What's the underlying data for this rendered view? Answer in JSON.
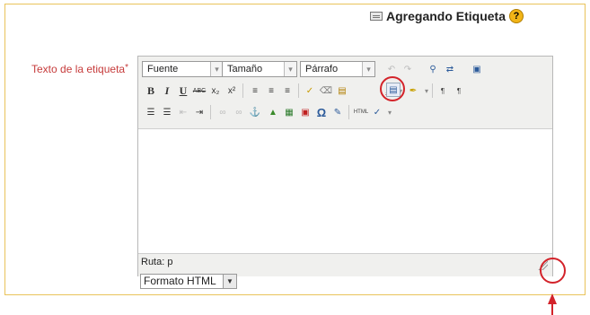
{
  "heading": {
    "title": "Agregando Etiqueta",
    "help_glyph": "?"
  },
  "field": {
    "label": "Texto de la etiqueta",
    "required_mark": "*"
  },
  "toolbar": {
    "font_select": "Fuente",
    "size_select": "Tamaño",
    "format_select": "Párrafo",
    "bold": "B",
    "italic": "I",
    "underline": "U",
    "strike": "ABC",
    "subscript": "x₂",
    "superscript": "x²",
    "text_color": "A",
    "omega": "Ω",
    "ltr": "¶",
    "rtl": "¶",
    "html": "HTML"
  },
  "statusbar": {
    "path": "Ruta: p"
  },
  "text_format": {
    "value": "Formato HTML"
  },
  "colors": {
    "frame_border": "#e9c35a",
    "label_red": "#c63b3b",
    "annotation_red": "#d3232a",
    "help_yellow": "#f2b517"
  },
  "icons": [
    "tag-icon",
    "help-icon",
    "bold-icon",
    "italic-icon",
    "underline-icon",
    "strikethrough-icon",
    "subscript-icon",
    "superscript-icon",
    "align-left-icon",
    "align-center-icon",
    "align-right-icon",
    "cleanup-icon",
    "eraser-icon",
    "paste-text-icon",
    "paste-word-icon",
    "text-color-icon",
    "highlight-color-icon",
    "ltr-icon",
    "rtl-icon",
    "bullet-list-icon",
    "numbered-list-icon",
    "outdent-icon",
    "indent-icon",
    "link-icon",
    "unlink-icon",
    "anchor-icon",
    "image-icon",
    "media-icon",
    "emoticon-icon",
    "special-char-icon",
    "table-icon",
    "html-source-icon",
    "spellcheck-icon",
    "resize-handle-icon"
  ]
}
